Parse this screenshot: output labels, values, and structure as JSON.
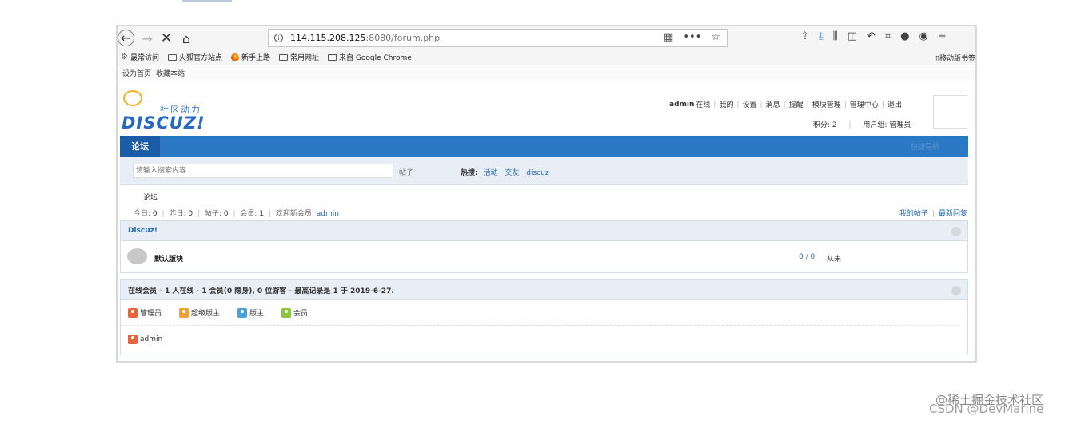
{
  "browser": {
    "url_host": "114.115.208.125",
    "url_path": ":8080/forum.php",
    "bookmarks": [
      "最常访问",
      "火狐官方站点",
      "新手上路",
      "常用网址",
      "来自 Google Chrome"
    ],
    "mobile_bookmarks": "移动版书签"
  },
  "favbar": {
    "set_home": "设为首页",
    "bookmark_site": "收藏本站"
  },
  "logo": {
    "sub": "社区动力",
    "word": "DISCUZ!"
  },
  "user_menu": {
    "username": "admin",
    "status": "在线",
    "items": [
      "我的",
      "设置",
      "消息",
      "提醒",
      "模块管理",
      "管理中心",
      "退出"
    ],
    "points_label": "积分: 2",
    "group_label": "用户组: 管理员"
  },
  "nav": {
    "tab": "论坛",
    "right": "快捷导航"
  },
  "search": {
    "placeholder": "请输入搜索内容",
    "type": "帖子",
    "hot_label": "热搜:",
    "hot_words": [
      "活动",
      "交友",
      "discuz"
    ]
  },
  "crumb": "论坛",
  "stats": {
    "today_label": "今日:",
    "today": "0",
    "yesterday_label": "昨日:",
    "yesterday": "0",
    "posts_label": "帖子:",
    "posts": "0",
    "members_label": "会员:",
    "members": "1",
    "welcome_label": "欢迎新会员:",
    "newest_member": "admin"
  },
  "my_links": {
    "my_posts": "我的帖子",
    "latest_replies": "最新回复"
  },
  "category": {
    "title": "Discuz!",
    "forum_name": "默认版块",
    "count_a": "0",
    "count_b": "0",
    "last_post": "从未"
  },
  "online": {
    "header": "在线会员 - 1 人在线 - 1 会员(0 隐身), 0 位游客 - 最高记录是 1 于 2019-6-27.",
    "legend": [
      {
        "label": "管理员",
        "color": "#e8643c"
      },
      {
        "label": "超级版主",
        "color": "#f0a030"
      },
      {
        "label": "版主",
        "color": "#4aa0dc"
      },
      {
        "label": "会员",
        "color": "#8cc43c"
      }
    ],
    "users": [
      "admin"
    ]
  },
  "watermark": {
    "line1": "@稀土掘金技术社区",
    "line2": "CSDN @DevMarine"
  }
}
